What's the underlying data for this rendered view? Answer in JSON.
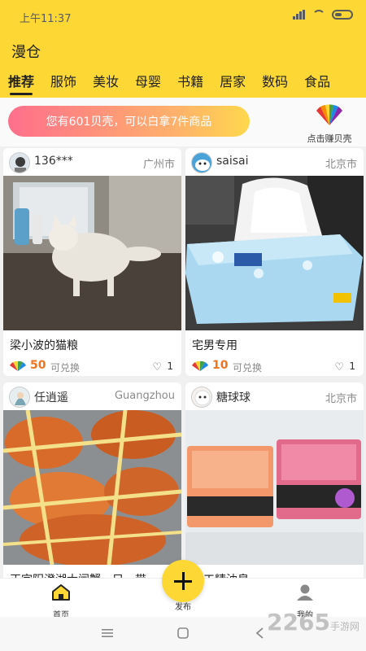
{
  "status_bar": {
    "time": "上午11:37"
  },
  "app": {
    "title": "漫仓"
  },
  "tabs": [
    {
      "label": "推荐",
      "active": true
    },
    {
      "label": "服饰"
    },
    {
      "label": "美妆"
    },
    {
      "label": "母婴"
    },
    {
      "label": "书籍"
    },
    {
      "label": "居家"
    },
    {
      "label": "数码"
    },
    {
      "label": "食品"
    }
  ],
  "banner": {
    "text": "您有601贝壳，可以白拿7件商品"
  },
  "earn": {
    "label": "点击赚贝壳",
    "icon": "colorful-shell-icon"
  },
  "cards": [
    {
      "user": "136***",
      "city": "广州市",
      "title": "梁小波的猫粮",
      "shells": "50",
      "exchange": "可兑换",
      "likes": "1"
    },
    {
      "user": "saisai",
      "city": "北京市",
      "title": "宅男专用",
      "shells": "10",
      "exchange": "可兑换",
      "likes": "1"
    },
    {
      "user": "任逍遥",
      "city": "Guangzhou",
      "title": "正宗阳澄湖大闸蟹一只，带"
    },
    {
      "user": "糖球球",
      "city": "北京市",
      "title": "手工精油皂"
    }
  ],
  "nav": {
    "home": "首页",
    "publish": "发布",
    "mine": "我的"
  },
  "watermark": {
    "brand": "2265",
    "suffix": "手游网"
  },
  "colors": {
    "brand_yellow": "#fdd835",
    "accent_orange": "#f0741b"
  }
}
